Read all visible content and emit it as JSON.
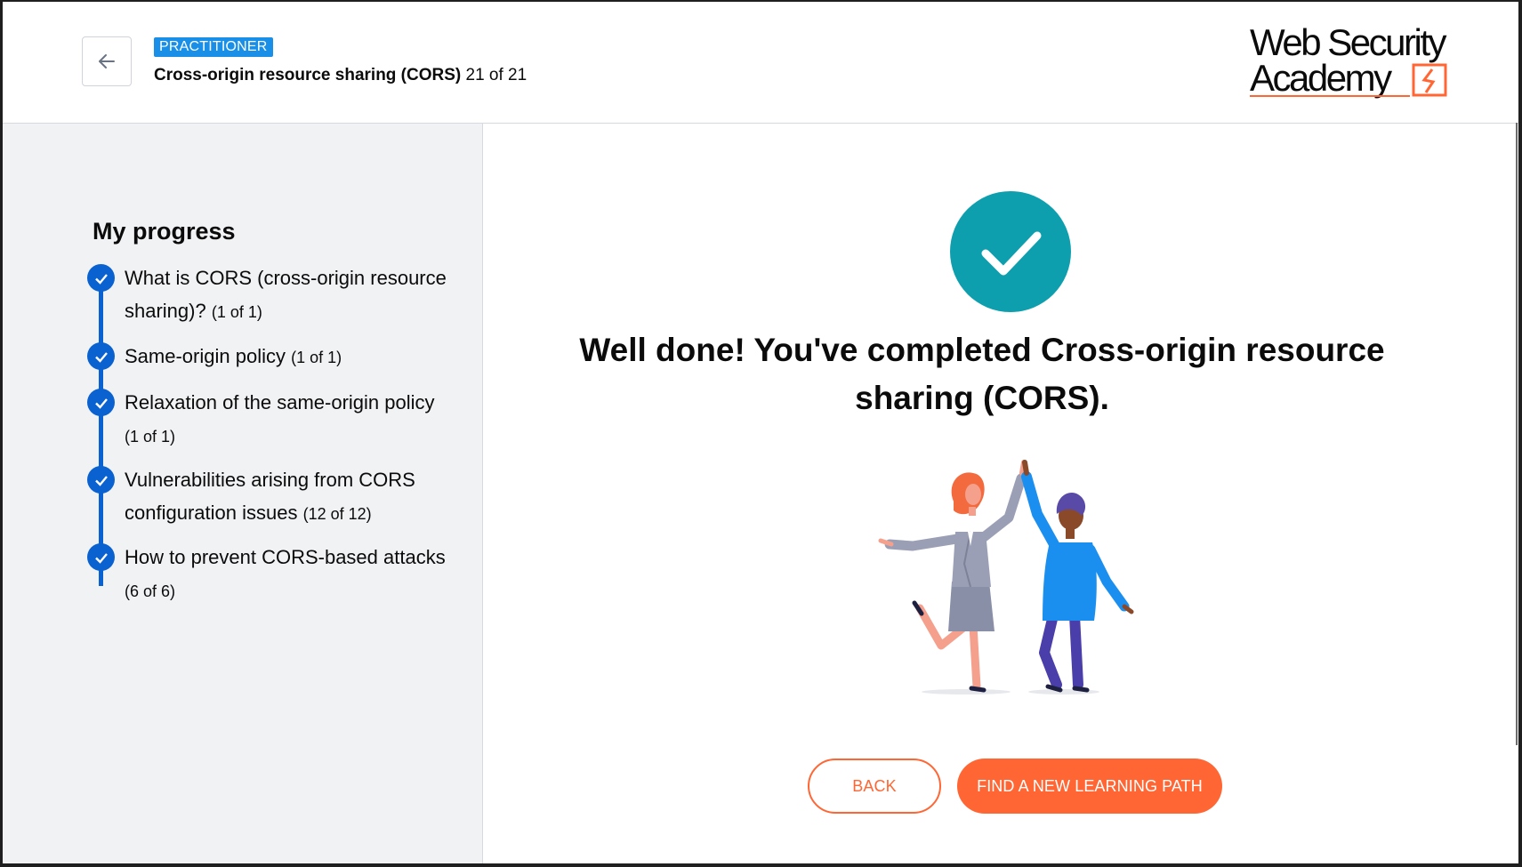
{
  "header": {
    "back_icon": "arrow-left-icon",
    "level_badge": "PRACTITIONER",
    "topic_name": "Cross-origin resource sharing (CORS)",
    "topic_progress": "21 of 21",
    "logo_line1": "Web Security",
    "logo_line2": "Academy"
  },
  "sidebar": {
    "title": "My progress",
    "items": [
      {
        "label": "What is CORS (cross-origin resource sharing)?",
        "count": "(1 of 1)"
      },
      {
        "label": "Same-origin policy",
        "count": "(1 of 1)"
      },
      {
        "label": "Relaxation of the same-origin policy",
        "count": "(1 of 1)"
      },
      {
        "label": "Vulnerabilities arising from CORS configuration issues",
        "count": "(12 of 12)"
      },
      {
        "label": "How to prevent CORS-based attacks",
        "count": "(6 of 6)"
      }
    ]
  },
  "main": {
    "headline": "Well done! You've completed Cross-origin resource sharing (CORS).",
    "back_button": "BACK",
    "find_button": "FIND A NEW LEARNING PATH"
  },
  "colors": {
    "accent_orange": "#ff6633",
    "progress_blue": "#0a62d0",
    "badge_blue": "#1a8fe8",
    "success_teal": "#0e9faf"
  }
}
